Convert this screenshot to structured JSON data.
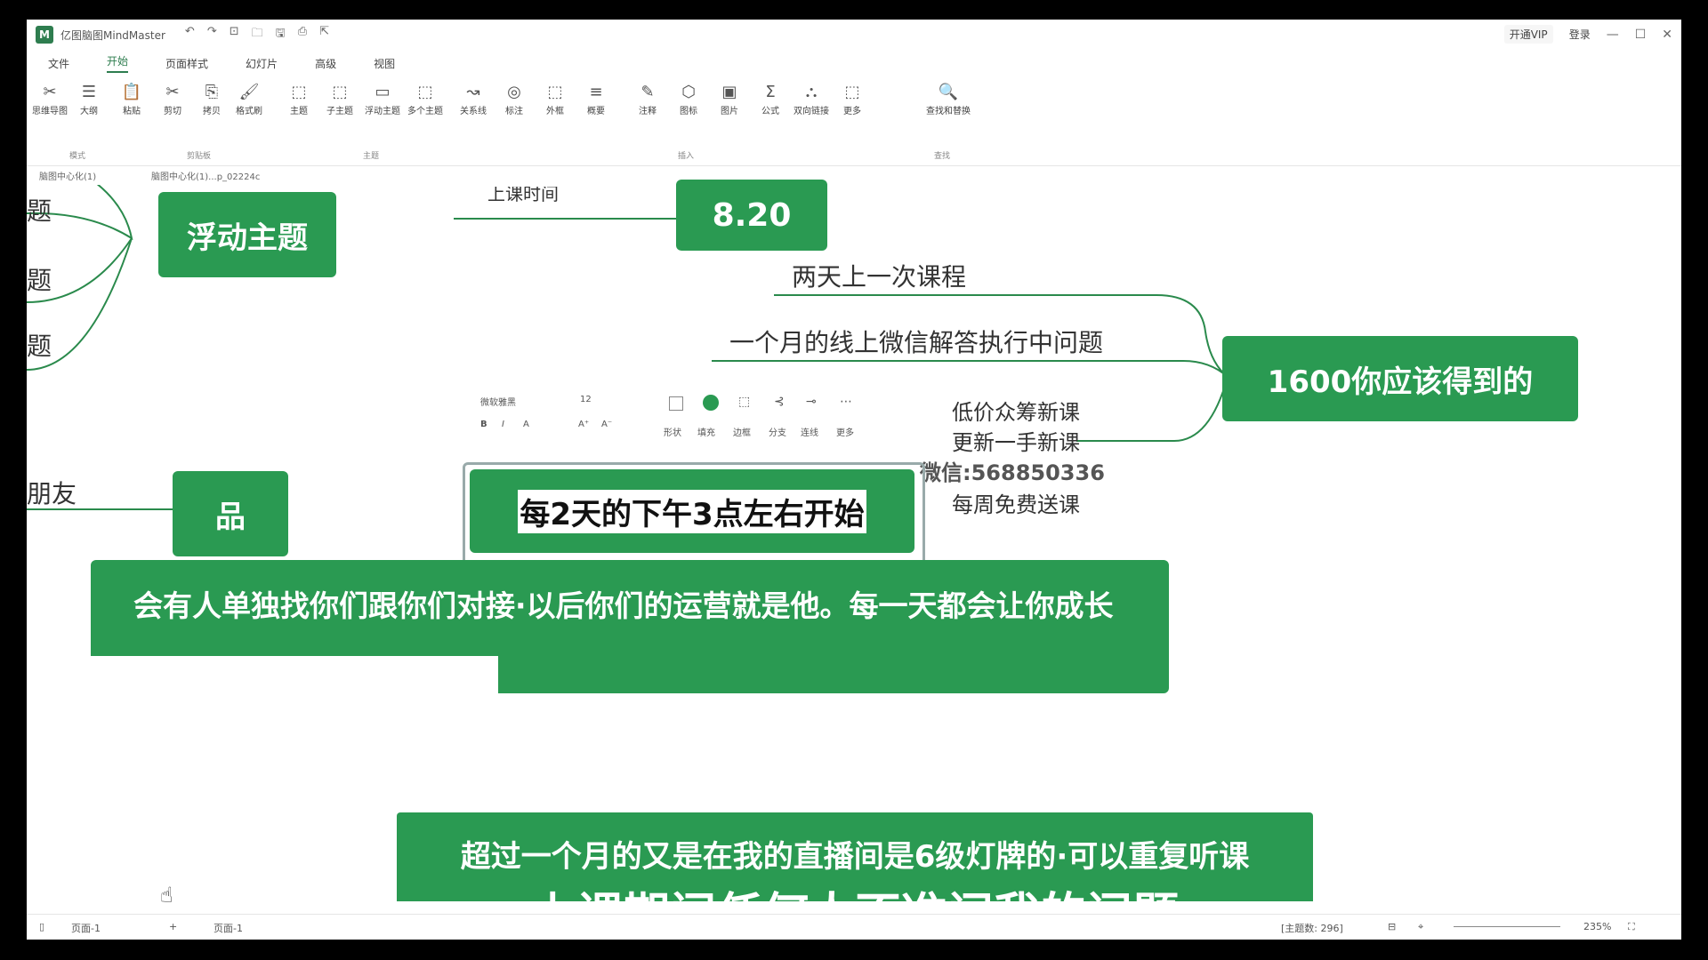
{
  "app": {
    "logo": "M",
    "title": "亿图脑图MindMaster"
  },
  "titlebar": {
    "vip_label": "开通VIP",
    "login_label": "登录",
    "minimize": "—",
    "maximize": "☐",
    "close": "✕"
  },
  "menu_tabs": [
    "文件",
    "开始",
    "页面样式",
    "幻灯片",
    "高级",
    "视图"
  ],
  "ribbon": {
    "tools": [
      {
        "icon": "✂",
        "label": "思维导图"
      },
      {
        "icon": "☰",
        "label": "大纲"
      },
      {
        "icon": "📋",
        "label": "粘贴"
      },
      {
        "icon": "✂",
        "label": "剪切"
      },
      {
        "icon": "⎘",
        "label": "拷贝"
      },
      {
        "icon": "🖌",
        "label": "格式刷"
      },
      {
        "icon": "⬚",
        "label": "主题"
      },
      {
        "icon": "⬚",
        "label": "子主题"
      },
      {
        "icon": "▭",
        "label": "浮动主题"
      },
      {
        "icon": "⬚",
        "label": "多个主题"
      },
      {
        "icon": "↝",
        "label": "关系线"
      },
      {
        "icon": "◎",
        "label": "标注"
      },
      {
        "icon": "⬚",
        "label": "外框"
      },
      {
        "icon": "≡",
        "label": "概要"
      },
      {
        "icon": "✎",
        "label": "注释"
      },
      {
        "icon": "⬡",
        "label": "图标"
      },
      {
        "icon": "▣",
        "label": "图片"
      },
      {
        "icon": "Σ",
        "label": "公式"
      },
      {
        "icon": "⛬",
        "label": "双向链接"
      },
      {
        "icon": "⬚",
        "label": "更多"
      },
      {
        "icon": "🔍",
        "label": "查找和替换"
      }
    ],
    "groups": [
      "模式",
      "剪贴板",
      "主题",
      "插入",
      "查找"
    ]
  },
  "doc_tabs": [
    "脑图中心化(1)",
    "脑图中心化(1)...p_02224c"
  ],
  "canvas": {
    "left_labels": [
      "题",
      "题",
      "题",
      "朋友"
    ],
    "nodes": {
      "float_topic": "浮动主题",
      "date_node": "8.20",
      "goal_node": "1600你应该得到的",
      "pin_node": "品",
      "editing_node": "每2天的下午3点左右开始",
      "banner_1": "会有人单独找你们跟你们对接·以后你们的运营就是他。每一天都会让你成长",
      "banner_2_line1": "超过一个月的又是在我的直播间是6级灯牌的·可以重复听课",
      "banner_2_line2": "上课期间任何人不准问我的问题"
    },
    "branch_labels": {
      "top_cut": "上课时间",
      "b1": "两天上一次课程",
      "b2": "一个月的线上微信解答执行中问题",
      "b3": "低价众筹新课",
      "b4": "更新一手新课",
      "b5": "微信:568850336",
      "b6": "每周免费送课"
    },
    "mini_toolbar": {
      "font_name": "微软雅黑",
      "font_size": "12",
      "tools": [
        "形状",
        "填充",
        "边框",
        "分支",
        "连线",
        "更多"
      ],
      "format": [
        "B",
        "I",
        "A",
        "A⁺",
        "A⁻"
      ]
    }
  },
  "statusbar": {
    "page": "页面-1",
    "add": "+",
    "page_tab": "页面-1",
    "count": "[主题数: 296]",
    "zoom": "235%"
  },
  "colors": {
    "node_green": "#2a9a52",
    "accent": "#2e7d4f"
  }
}
